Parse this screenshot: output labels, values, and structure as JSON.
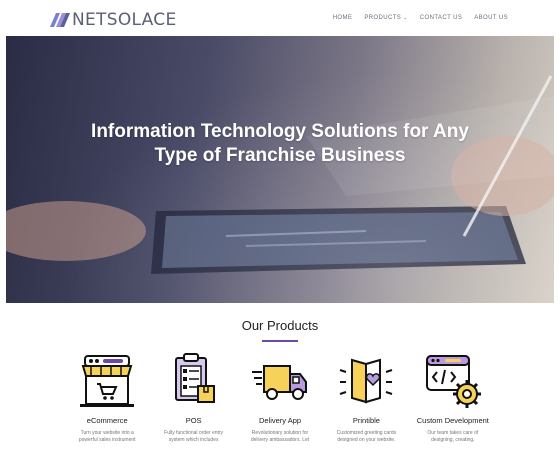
{
  "header": {
    "logo_text": "NETSOLACE",
    "nav": [
      {
        "label": "HOME"
      },
      {
        "label": "PRODUCTS"
      },
      {
        "label": "CONTACT US"
      },
      {
        "label": "ABOUT US"
      }
    ],
    "dropdown_caret": "⌄"
  },
  "hero": {
    "title_line1": "Information Technology Solutions for Any",
    "title_line2": "Type of Franchise Business"
  },
  "products_section": {
    "title": "Our Products",
    "accent_color": "#6b4aa6",
    "items": [
      {
        "name": "eCommerce",
        "icon": "storefront-cart-icon",
        "desc_line1": "Turn your website into a",
        "desc_line2": "powerful sales instrument"
      },
      {
        "name": "POS",
        "icon": "clipboard-box-icon",
        "desc_line1": "Fully functional order entry",
        "desc_line2": "system which includes"
      },
      {
        "name": "Delivery App",
        "icon": "delivery-truck-icon",
        "desc_line1": "Revolutionary solution for",
        "desc_line2": "delivery ambassadors. Let"
      },
      {
        "name": "Printible",
        "icon": "greeting-card-icon",
        "desc_line1": "Customized greeting cards",
        "desc_line2": "designed on your website."
      },
      {
        "name": "Custom Development",
        "icon": "code-gear-icon",
        "desc_line1": "Our team takes care of",
        "desc_line2": "designing, creating,"
      }
    ]
  }
}
